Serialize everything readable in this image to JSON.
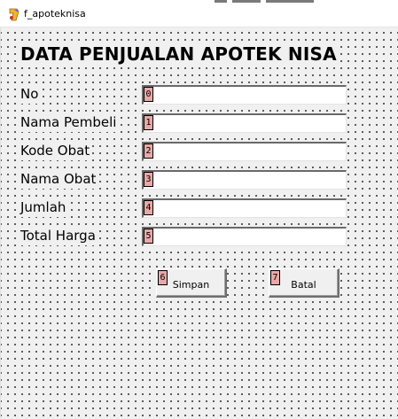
{
  "window": {
    "title": "f_apoteknisa",
    "icon": "delphi-form-icon"
  },
  "form": {
    "heading": "DATA PENJUALAN APOTEK NISA",
    "fields": [
      {
        "label": "No",
        "tab_order": "0",
        "value": ""
      },
      {
        "label": "Nama Pembeli",
        "tab_order": "1",
        "value": ""
      },
      {
        "label": "Kode Obat",
        "tab_order": "2",
        "value": ""
      },
      {
        "label": "Nama Obat",
        "tab_order": "3",
        "value": ""
      },
      {
        "label": "Jumlah",
        "tab_order": "4",
        "value": ""
      },
      {
        "label": "Total Harga",
        "tab_order": "5",
        "value": ""
      }
    ],
    "buttons": {
      "save": {
        "label": "Simpan",
        "tab_order": "6"
      },
      "cancel": {
        "label": "Batal",
        "tab_order": "7"
      }
    }
  },
  "colors": {
    "tab_badge": "#e8a8a8",
    "form_background": "#f0f0f0",
    "grid_dots": "#000000"
  }
}
